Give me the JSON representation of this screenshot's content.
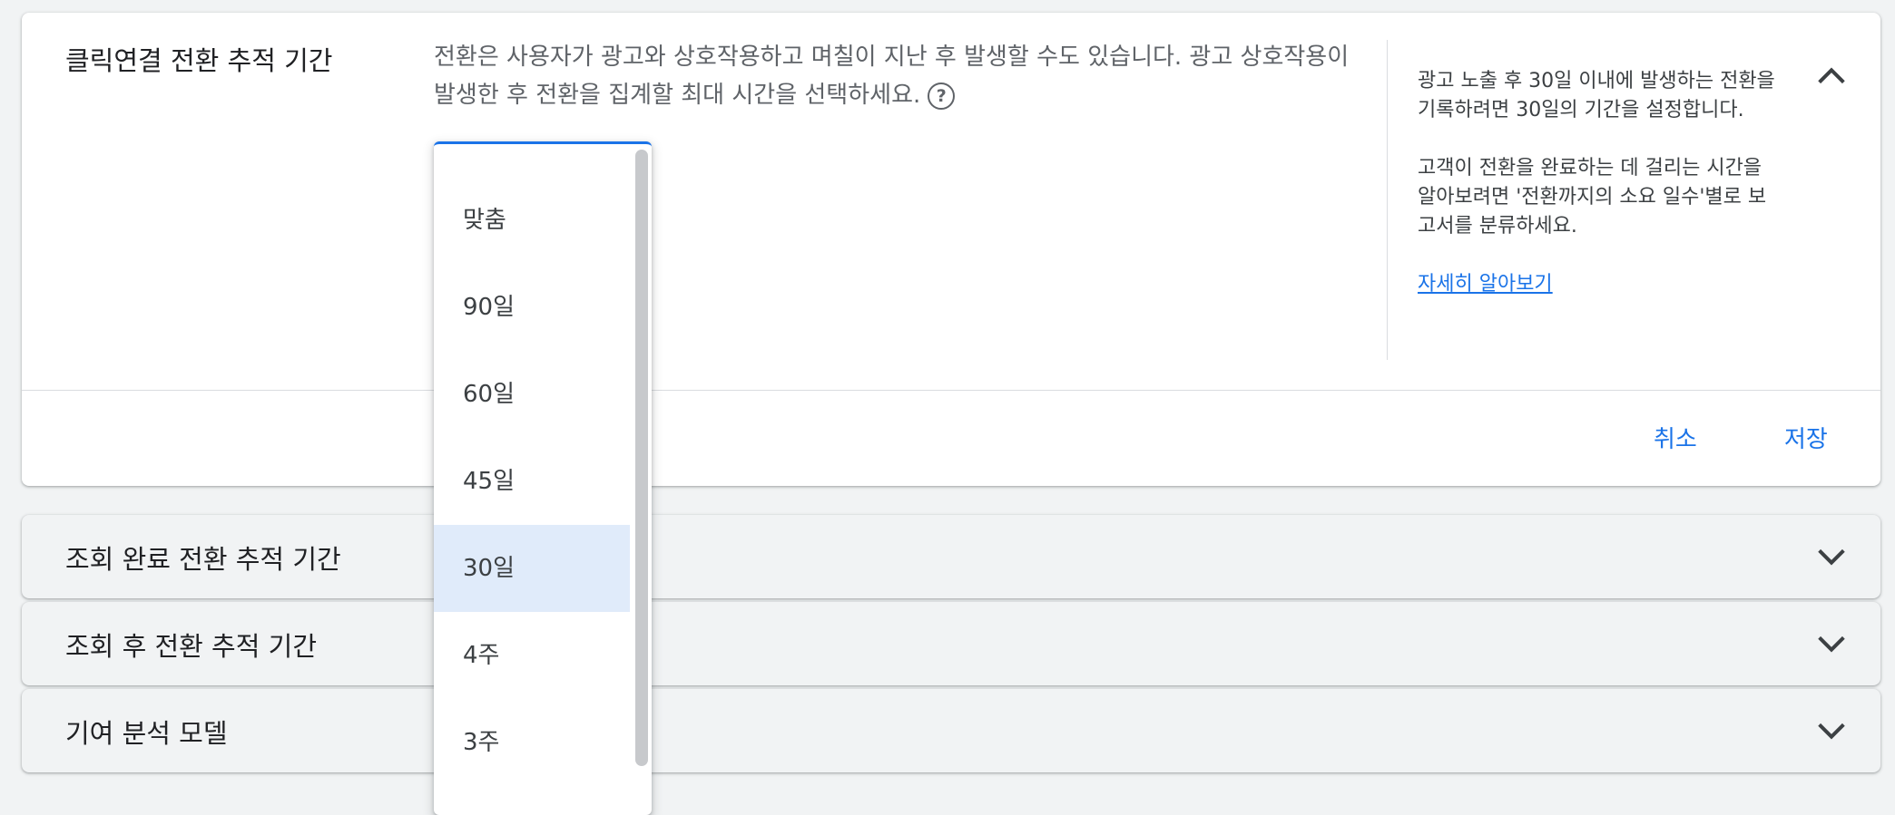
{
  "click_section": {
    "title": "클릭연결 전환 추적 기간",
    "description": "전환은 사용자가 광고와 상호작용하고 며칠이 지난 후 발생할 수도 있습니다. 광고 상호작용이 발생한 후 전환을 집계할 최대 시간을 선택하세요.",
    "help_icon": "help-circle-icon",
    "collapse_icon": "chevron-up-icon",
    "side_panel": {
      "paragraph1": "광고 노출 후 30일 이내에 발생하는 전환을 기록하려면 30일의 기간을 설정합니다.",
      "paragraph2": "고객이 전환을 완료하는 데 걸리는 시간을 알아보려면 '전환까지의 소요 일수'별로 보고서를 분류하세요.",
      "link": "자세히 알아보기"
    },
    "cancel_label": "취소",
    "save_label": "저장",
    "dropdown": {
      "selected": "30일",
      "options": [
        "맞춤",
        "90일",
        "60일",
        "45일",
        "30일",
        "4주",
        "3주"
      ]
    }
  },
  "view_complete_section": {
    "title": "조회 완료 전환 추적 기간",
    "expand_icon": "chevron-down-icon"
  },
  "view_through_section": {
    "title": "조회 후 전환 추적 기간",
    "expand_icon": "chevron-down-icon"
  },
  "attribution_section": {
    "title": "기여 분석 모델",
    "expand_icon": "chevron-down-icon"
  },
  "colors": {
    "accent": "#1a73e8",
    "selected_bg": "#e0ebfa",
    "page_bg": "#f1f3f4"
  }
}
